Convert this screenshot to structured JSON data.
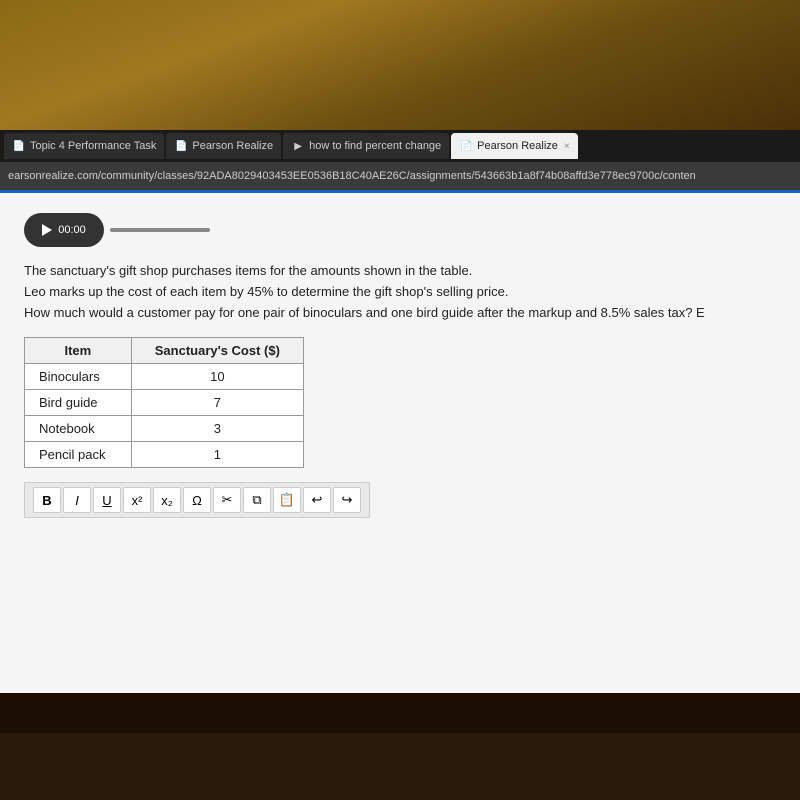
{
  "browser": {
    "tabs": [
      {
        "id": "tab1",
        "label": "Topic 4 Performance Task",
        "icon": "📄",
        "active": false
      },
      {
        "id": "tab2",
        "label": "Pearson Realize",
        "icon": "📄",
        "active": false
      },
      {
        "id": "tab3",
        "label": "how to find percent change",
        "icon": "▶",
        "active": false
      },
      {
        "id": "tab4",
        "label": "Pearson Realize",
        "icon": "📄",
        "active": true,
        "close": "×"
      }
    ],
    "address": "earsonrealize.com/community/classes/92ADA8029403453EE0536B18C40AE26C/assignments/543663b1a8f74b08affd3e778ec9700c/conten"
  },
  "video": {
    "time": "00:00"
  },
  "question": {
    "line1": "The sanctuary's gift shop purchases items for the amounts shown in the table.",
    "line2": "Leo marks up the cost of each item by 45% to determine the gift shop's selling price.",
    "line3": "How much would a customer pay for one pair of binoculars and one bird guide after the markup and 8.5% sales tax? E"
  },
  "table": {
    "headers": [
      "Item",
      "Sanctuary's Cost ($)"
    ],
    "rows": [
      {
        "item": "Binoculars",
        "cost": "10"
      },
      {
        "item": "Bird guide",
        "cost": "7"
      },
      {
        "item": "Notebook",
        "cost": "3"
      },
      {
        "item": "Pencil pack",
        "cost": "1"
      }
    ]
  },
  "toolbar": {
    "buttons": [
      {
        "id": "bold",
        "label": "B",
        "name": "bold-button"
      },
      {
        "id": "italic",
        "label": "I",
        "name": "italic-button"
      },
      {
        "id": "underline",
        "label": "U",
        "name": "underline-button"
      },
      {
        "id": "superscript",
        "label": "x²",
        "name": "superscript-button"
      },
      {
        "id": "subscript",
        "label": "x₂",
        "name": "subscript-button"
      },
      {
        "id": "omega",
        "label": "Ω",
        "name": "omega-button"
      },
      {
        "id": "scissors",
        "label": "✂",
        "name": "scissors-button"
      },
      {
        "id": "copy",
        "label": "⧉",
        "name": "copy-button"
      },
      {
        "id": "paste",
        "label": "📋",
        "name": "paste-button"
      },
      {
        "id": "undo",
        "label": "↩",
        "name": "undo-button"
      },
      {
        "id": "redo",
        "label": "↪",
        "name": "redo-button"
      }
    ]
  }
}
